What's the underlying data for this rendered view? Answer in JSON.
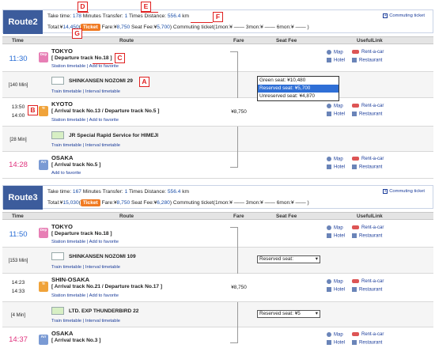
{
  "route2": {
    "tag": "Route2",
    "take_time_label": "Take time:",
    "take_time_value": "178",
    "take_time_unit": "Minutes",
    "transfer_label": "Transfer:",
    "transfer_value": "1",
    "transfer_unit": "Times",
    "distance_label": "Distance:",
    "distance_value": "556.4",
    "distance_unit": "km",
    "total_label": "Total:¥",
    "total_value": "14,450",
    "ticket_label": "Ticket",
    "fare_label": "Fare:¥",
    "fare_value": "8,750",
    "seatfee_label": "Seat Fee:¥",
    "seatfee_value": "5,700",
    "commuting_label": "Commuting ticket(1mon:¥",
    "commuting_3mon": "3mon:¥",
    "commuting_6mon": "6mon:¥",
    "commuting_link": "Commuting ticket"
  },
  "route3": {
    "tag": "Route3",
    "take_time_label": "Take time:",
    "take_time_value": "167",
    "take_time_unit": "Minutes",
    "transfer_label": "Transfer:",
    "transfer_value": "1",
    "transfer_unit": "Times",
    "distance_label": "Distance:",
    "distance_value": "556.4",
    "distance_unit": "km",
    "total_label": "Total:¥",
    "total_value": "15,030",
    "ticket_label": "Ticket",
    "fare_label": "Fare:¥",
    "fare_value": "8,750",
    "seatfee_label": "Seat Fee:¥",
    "seatfee_value": "6,280",
    "commuting_label": "Commuting ticket(1mon:¥",
    "commuting_3mon": "3mon:¥",
    "commuting_6mon": "6mon:¥",
    "commuting_link": "Commuting ticket"
  },
  "columns": {
    "time": "Time",
    "route": "Route",
    "fare": "Fare",
    "seat_fee": "Seat Fee",
    "useful_link": "UsefulLink"
  },
  "r2": {
    "tokyo_time": "11:30",
    "tokyo_name": "TOKYO",
    "tokyo_track": "[ Departure track No.18 ]",
    "tokyo_links_a": "Station timetable",
    "tokyo_links_b": "Add to favorite",
    "train1_dur": "[140 Min]",
    "train1_name": "SHINKANSEN NOZOMI 29",
    "train1_links_a": "Train timetable",
    "train1_links_b": "Interval timetable",
    "kyoto_time_arr": "13:50",
    "kyoto_time_dep": "14:00",
    "kyoto_name": "KYOTO",
    "kyoto_track": "[ Arrival track No.13 / Departure track No.5 ]",
    "kyoto_links_a": "Station timetable",
    "kyoto_links_b": "Add to favorite",
    "kyoto_fare": "¥8,750",
    "train2_dur": "[28 Min]",
    "train2_name": "JR Special Rapid Service for HIMEJI",
    "train2_links_a": "Train timetable",
    "train2_links_b": "Interval timetable",
    "osaka_time": "14:28",
    "osaka_name": "OSAKA",
    "osaka_track": "[ Arrival track No.5 ]",
    "osaka_links": "Add to favorite",
    "dropdown_options": [
      "Green seat: ¥10,480",
      "Reserved seat: ¥5,700",
      "Unreserved seat: ¥4,870"
    ]
  },
  "r3": {
    "tokyo_time": "11:50",
    "tokyo_name": "TOKYO",
    "tokyo_track": "[ Departure track No.18 ]",
    "tokyo_links_a": "Station timetable",
    "tokyo_links_b": "Add to favorite",
    "train1_dur": "[153 Min]",
    "train1_name": "SHINKANSEN NOZOMI 109",
    "train1_links_a": "Train timetable",
    "train1_links_b": "Interval timetable",
    "train1_seat": "Reserved seat:",
    "shin_time_arr": "14:23",
    "shin_time_dep": "14:33",
    "shin_name": "SHIN-OSAKA",
    "shin_track": "[ Arrival track No.21 / Departure track No.17 ]",
    "shin_links_a": "Station timetable",
    "shin_links_b": "Add to favorite",
    "shin_fare": "¥8,750",
    "train2_dur": "[4 Min]",
    "train2_name": "LTD. EXP THUNDERBIRD 22",
    "train2_links_a": "Train timetable",
    "train2_links_b": "Interval timetable",
    "train2_seat": "Reserved seat: ¥5",
    "osaka_time": "14:37",
    "osaka_name": "OSAKA",
    "osaka_track": "[ Arrival track No.3 ]"
  },
  "icons": {
    "dep": "Dep",
    "arr": "Arr",
    "tr": "Tr"
  },
  "useful": {
    "map": "Map",
    "rent": "Rent-a-car",
    "hotel": "Hotel",
    "restaurant": "Restaurant"
  },
  "callouts": {
    "a": "A",
    "b": "B",
    "c": "C",
    "d": "D",
    "e": "E",
    "f": "F",
    "g": "G"
  }
}
